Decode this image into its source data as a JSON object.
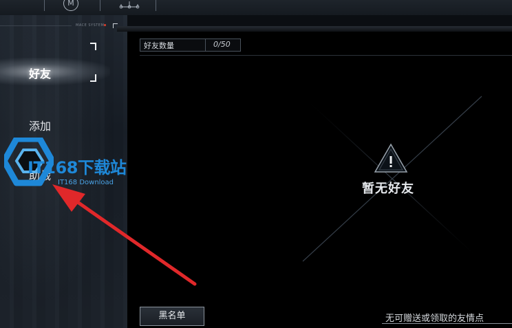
{
  "topbar": {
    "logo_letter": "M",
    "system_label": "MACE SYSTEM"
  },
  "nav": {
    "items": [
      {
        "label": "好友",
        "active": true
      },
      {
        "label": "添加",
        "active": false
      },
      {
        "label": "助战",
        "active": false
      }
    ]
  },
  "main": {
    "friend_count_label": "好友数量",
    "friend_count_value": "0/50",
    "empty_message": "暂无好友",
    "blacklist_button": "黑名单",
    "footer_note": "无可赠送或领取的友情点"
  },
  "watermark": {
    "brand": "IT168下载站",
    "sub": "IT168 Download"
  },
  "colors": {
    "accent_red": "#e0282a",
    "watermark_blue": "#1e88d8",
    "panel_bg": "#000000"
  }
}
